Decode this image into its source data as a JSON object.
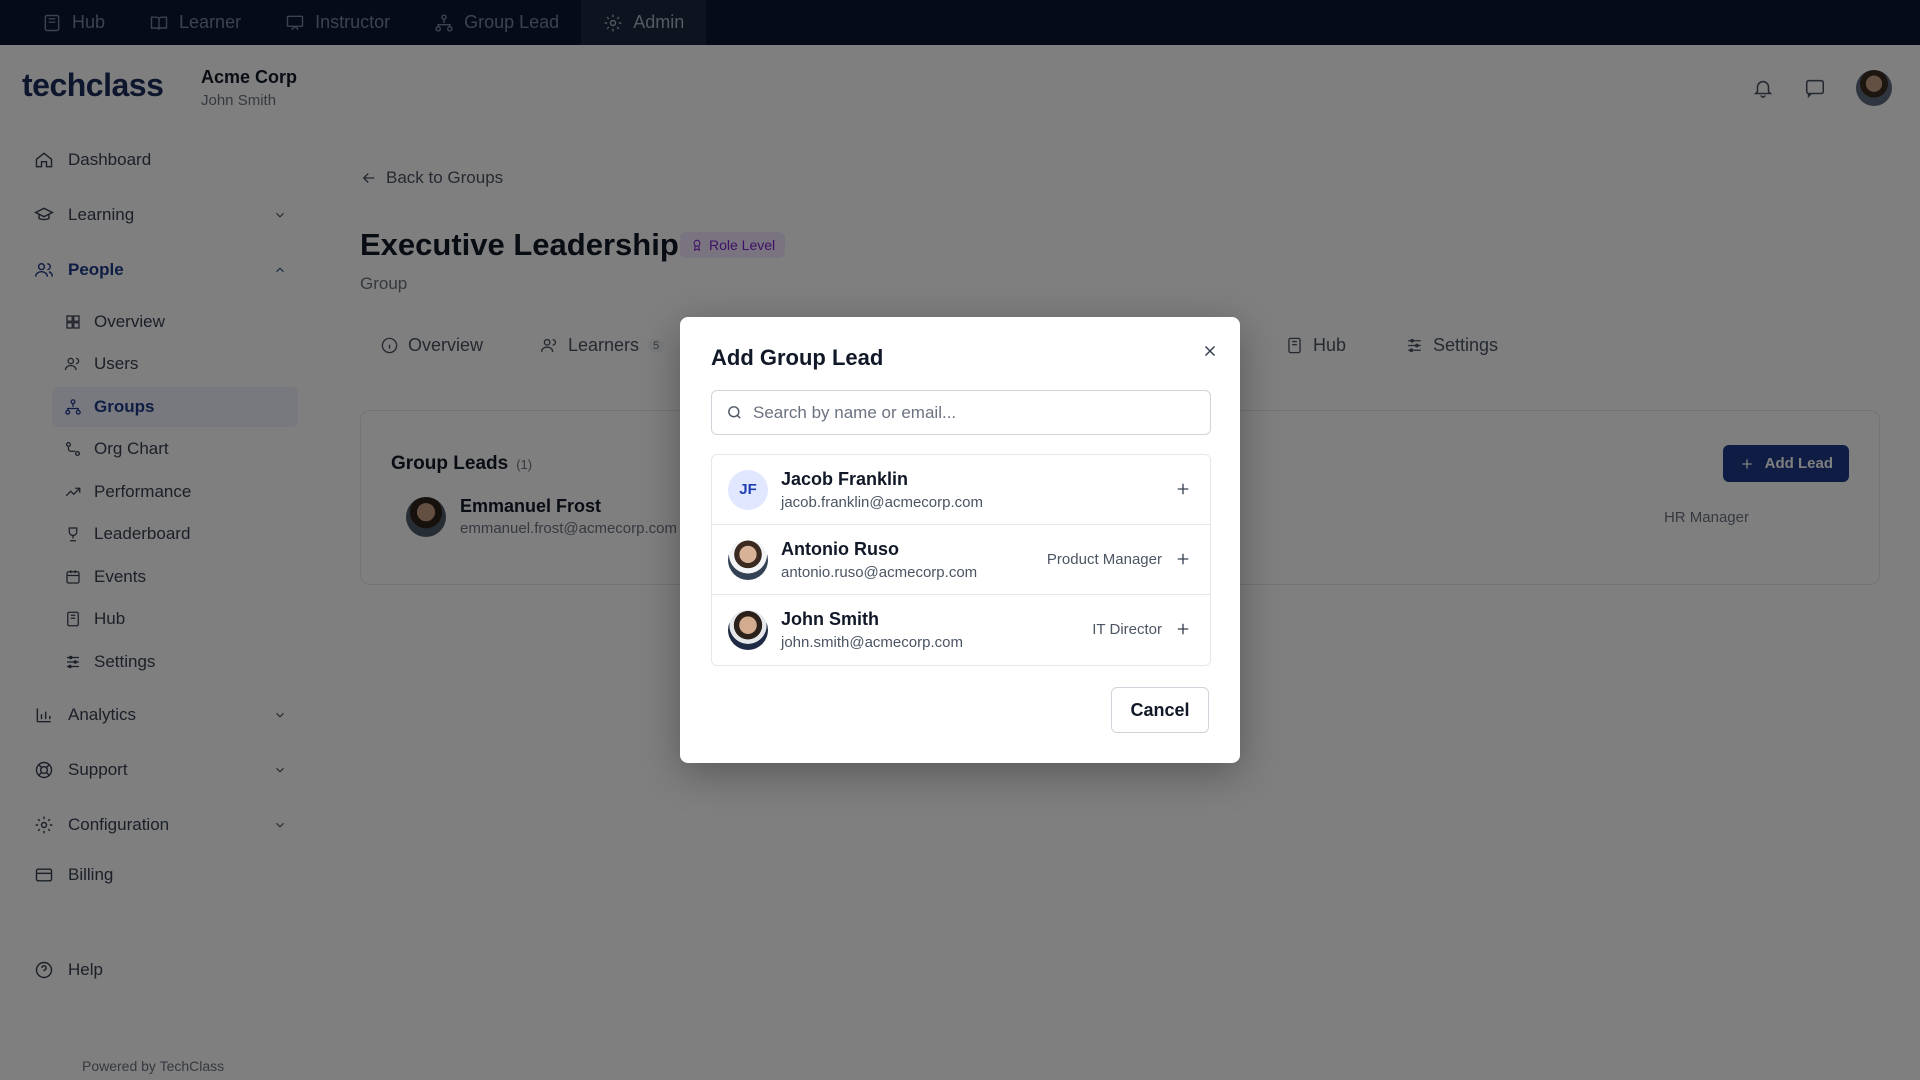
{
  "topbar": {
    "items": [
      {
        "label": "Hub",
        "icon": "book-icon"
      },
      {
        "label": "Learner",
        "icon": "open-book-icon"
      },
      {
        "label": "Instructor",
        "icon": "presentation-icon"
      },
      {
        "label": "Group Lead",
        "icon": "hierarchy-icon"
      },
      {
        "label": "Admin",
        "icon": "gear-icon",
        "active": true
      }
    ]
  },
  "header": {
    "logo": "techclass",
    "org_name": "Acme Corp",
    "org_user": "John Smith"
  },
  "sidebar": {
    "items": [
      {
        "label": "Dashboard"
      },
      {
        "label": "Learning"
      },
      {
        "label": "People"
      },
      {
        "label": "Analytics"
      },
      {
        "label": "Support"
      },
      {
        "label": "Configuration"
      },
      {
        "label": "Billing"
      },
      {
        "label": "Help"
      }
    ],
    "people_sub": [
      {
        "label": "Overview"
      },
      {
        "label": "Users"
      },
      {
        "label": "Groups"
      },
      {
        "label": "Org Chart"
      },
      {
        "label": "Performance"
      },
      {
        "label": "Leaderboard"
      },
      {
        "label": "Events"
      },
      {
        "label": "Hub"
      },
      {
        "label": "Settings"
      }
    ],
    "powered_by": "Powered by TechClass"
  },
  "page": {
    "back_label": "Back to Groups",
    "title": "Executive Leadership",
    "badge": "Role Level",
    "subtitle": "Group",
    "tabs": [
      {
        "label": "Overview"
      },
      {
        "label": "Learners",
        "count": "5"
      },
      {
        "label": "Hub"
      },
      {
        "label": "Settings"
      }
    ],
    "card": {
      "title": "Group Leads",
      "count": "(1)",
      "add_button": "Add Lead",
      "lead_name": "Emmanuel Frost",
      "lead_email": "emmanuel.frost@acmecorp.com",
      "lead_role": "HR Manager"
    }
  },
  "modal": {
    "title": "Add Group Lead",
    "search_placeholder": "Search by name or email...",
    "people": [
      {
        "initials": "JF",
        "name": "Jacob Franklin",
        "email": "jacob.franklin@acmecorp.com",
        "role": ""
      },
      {
        "name": "Antonio Ruso",
        "email": "antonio.ruso@acmecorp.com",
        "role": "Product Manager"
      },
      {
        "name": "John Smith",
        "email": "john.smith@acmecorp.com",
        "role": "IT Director"
      }
    ],
    "cancel_label": "Cancel"
  }
}
